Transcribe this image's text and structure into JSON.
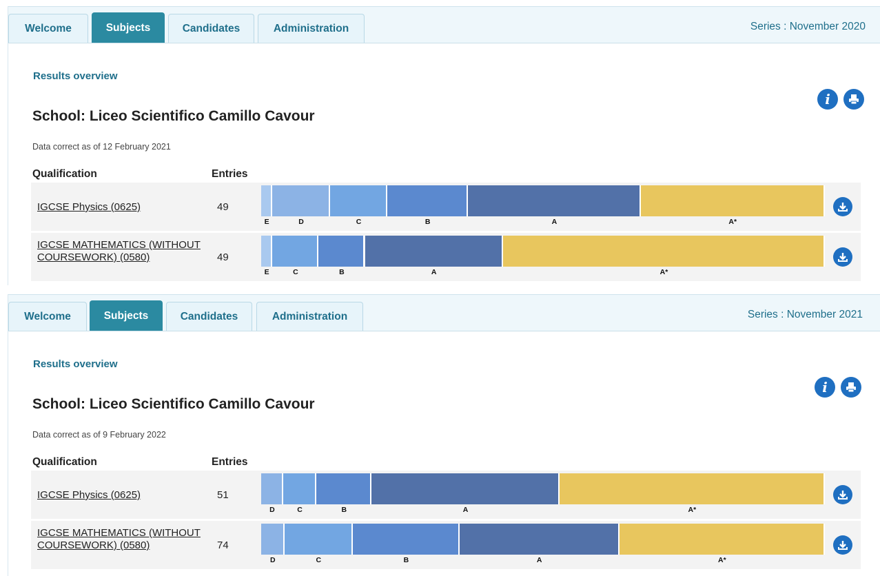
{
  "colors": {
    "accent": "#2b8aa1",
    "grade_E": "#a9c9ef",
    "grade_D": "#8cb3e5",
    "grade_C": "#72a6e2",
    "grade_B": "#5b89cf",
    "grade_A": "#5271a8",
    "grade_Astar": "#e8c65e"
  },
  "icons": {
    "info": "info-icon",
    "print": "print-icon",
    "download": "download-icon"
  },
  "panels": [
    {
      "tabs": [
        "Welcome",
        "Subjects",
        "Candidates",
        "Administration"
      ],
      "active_tab": "Subjects",
      "series": "Series : November 2020",
      "overview": "Results overview",
      "school": "School: Liceo Scientifico Camillo Cavour",
      "data_correct": "Data correct as of 12 February 2021",
      "headers": {
        "qualification": "Qualification",
        "entries": "Entries"
      },
      "rows": [
        {
          "qualification": "IGCSE Physics (0625)",
          "entries": "49",
          "grades": [
            {
              "grade": "E",
              "share": 0.02
            },
            {
              "grade": "D",
              "share": 0.102
            },
            {
              "grade": "C",
              "share": 0.102
            },
            {
              "grade": "B",
              "share": 0.143
            },
            {
              "grade": "A",
              "share": 0.306
            },
            {
              "grade": "A*",
              "share": 0.327
            }
          ]
        },
        {
          "qualification": "IGCSE MATHEMATICS (WITHOUT COURSEWORK) (0580)",
          "entries": "49",
          "grades": [
            {
              "grade": "E",
              "share": 0.02
            },
            {
              "grade": "C",
              "share": 0.082
            },
            {
              "grade": "B",
              "share": 0.082
            },
            {
              "grade": "A",
              "share": 0.245
            },
            {
              "grade": "A*",
              "share": 0.571
            }
          ]
        }
      ]
    },
    {
      "tabs": [
        "Welcome",
        "Subjects",
        "Candidates",
        "Administration"
      ],
      "active_tab": "Subjects",
      "series": "Series : November 2021",
      "overview": "Results overview",
      "school": "School: Liceo Scientifico Camillo Cavour",
      "data_correct": "Data correct as of 9 February 2022",
      "headers": {
        "qualification": "Qualification",
        "entries": "Entries"
      },
      "rows": [
        {
          "qualification": "IGCSE Physics (0625)",
          "entries": "51",
          "grades": [
            {
              "grade": "D",
              "share": 0.039
            },
            {
              "grade": "C",
              "share": 0.059
            },
            {
              "grade": "B",
              "share": 0.098
            },
            {
              "grade": "A",
              "share": 0.333
            },
            {
              "grade": "A*",
              "share": 0.471
            }
          ]
        },
        {
          "qualification": "IGCSE MATHEMATICS (WITHOUT COURSEWORK) (0580)",
          "entries": "74",
          "grades": [
            {
              "grade": "D",
              "share": 0.041
            },
            {
              "grade": "C",
              "share": 0.122
            },
            {
              "grade": "B",
              "share": 0.189
            },
            {
              "grade": "A",
              "share": 0.284
            },
            {
              "grade": "A*",
              "share": 0.365
            }
          ]
        }
      ]
    }
  ]
}
